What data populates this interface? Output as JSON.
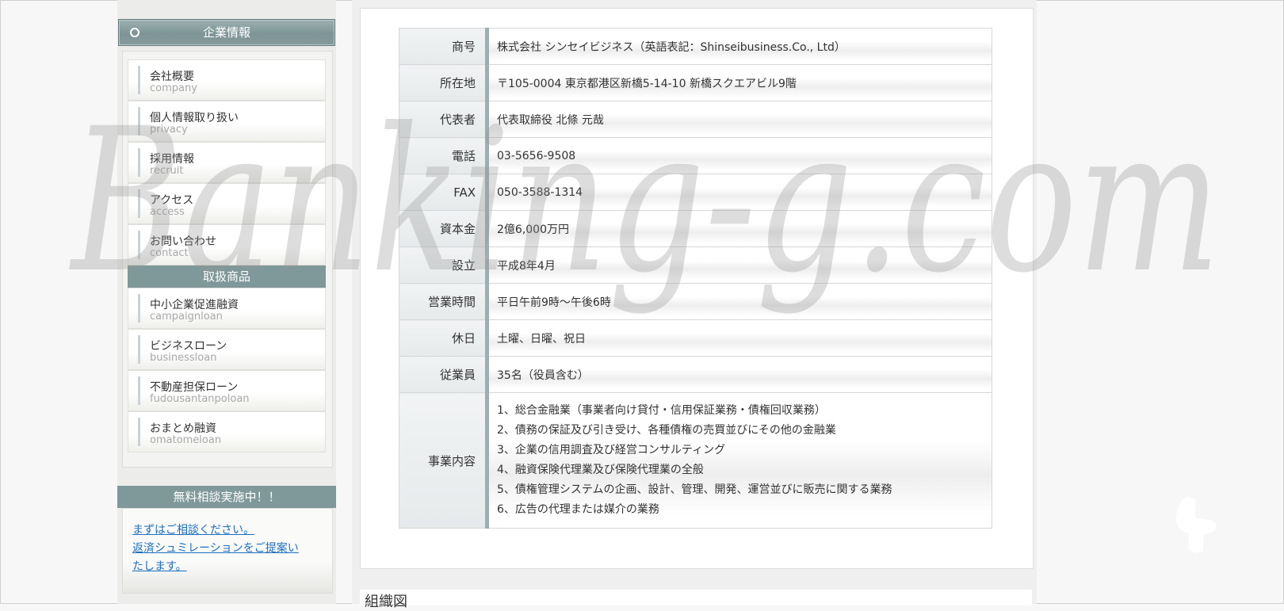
{
  "sidebar": {
    "company_heading": "企業情報",
    "company_items": [
      {
        "jp": "会社概要",
        "en": "company"
      },
      {
        "jp": "個人情報取り扱い",
        "en": "privacy"
      },
      {
        "jp": "採用情報",
        "en": "recruit"
      },
      {
        "jp": "アクセス",
        "en": "access"
      },
      {
        "jp": "お問い合わせ",
        "en": "contact"
      }
    ],
    "products_heading": "取扱商品",
    "product_items": [
      {
        "jp": "中小企業促進融資",
        "en": "campaignloan"
      },
      {
        "jp": "ビジネスローン",
        "en": "businessloan"
      },
      {
        "jp": "不動産担保ローン",
        "en": "fudousantanpoloan"
      },
      {
        "jp": "おまとめ融資",
        "en": "omatomeloan"
      }
    ],
    "consult_heading": "無料相談実施中！！",
    "consult_links": [
      "まずはご相談ください。",
      "返済シュミレーションをご提案い",
      "たします。"
    ]
  },
  "company_table": {
    "rows": [
      {
        "label": "商号",
        "value": "株式会社 シンセイビジネス（英語表記：Shinseibusiness.Co., Ltd）"
      },
      {
        "label": "所在地",
        "value": "〒105-0004 東京都港区新橋5-14-10 新橋スクエアビル9階"
      },
      {
        "label": "代表者",
        "value": "代表取締役 北條 元哉"
      },
      {
        "label": "電話",
        "value": "03-5656-9508"
      },
      {
        "label": "FAX",
        "value": "050-3588-1314"
      },
      {
        "label": "資本金",
        "value": "2億6,000万円"
      },
      {
        "label": "設立",
        "value": "平成8年4月"
      },
      {
        "label": "営業時間",
        "value": "平日午前9時～午後6時"
      },
      {
        "label": "休日",
        "value": "土曜、日曜、祝日"
      },
      {
        "label": "従業員",
        "value": "35名（役員含む）"
      }
    ],
    "business_label": "事業内容",
    "business_items": [
      "1、総合金融業（事業者向け貸付・信用保証業務・債権回収業務）",
      "2、債務の保証及び引き受け、各種債権の売買並びにその他の金融業",
      "3、企業の信用調査及び経営コンサルティング",
      "4、融資保険代理業及び保険代理業の全般",
      "5、債権管理システムの企画、設計、管理、開発、運営並びに販売に関する業務",
      "6、広告の代理または媒介の業務"
    ]
  },
  "org_chart_heading": "組織図",
  "watermark_text": "Banking-g.com",
  "colors": {
    "accent": "#7f9899",
    "link": "#1c6fc0",
    "label_bar": "#9eaeb1"
  }
}
